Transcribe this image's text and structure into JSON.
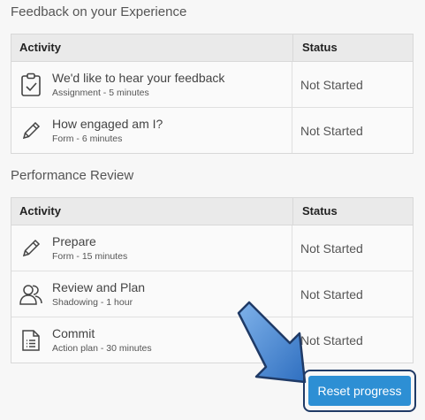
{
  "sections": [
    {
      "title": "Feedback on your Experience",
      "headers": {
        "activity": "Activity",
        "status": "Status"
      },
      "rows": [
        {
          "icon": "clipboard-icon",
          "title": "We'd like to hear your feedback",
          "subtitle": "Assignment - 5 minutes",
          "status": "Not Started"
        },
        {
          "icon": "pencil-icon",
          "title": "How engaged am I?",
          "subtitle": "Form - 6 minutes",
          "status": "Not Started"
        }
      ]
    },
    {
      "title": "Performance Review",
      "headers": {
        "activity": "Activity",
        "status": "Status"
      },
      "rows": [
        {
          "icon": "pencil-icon",
          "title": "Prepare",
          "subtitle": "Form - 15 minutes",
          "status": "Not Started"
        },
        {
          "icon": "people-icon",
          "title": "Review and Plan",
          "subtitle": "Shadowing - 1 hour",
          "status": "Not Started"
        },
        {
          "icon": "document-list-icon",
          "title": "Commit",
          "subtitle": "Action plan - 30 minutes",
          "status": "Not Started"
        }
      ]
    }
  ],
  "reset_button": {
    "label": "Reset progress"
  },
  "colors": {
    "button": "#2d8fd4",
    "button_outline": "#1f3a66",
    "arrow": "#3b7fd0"
  }
}
